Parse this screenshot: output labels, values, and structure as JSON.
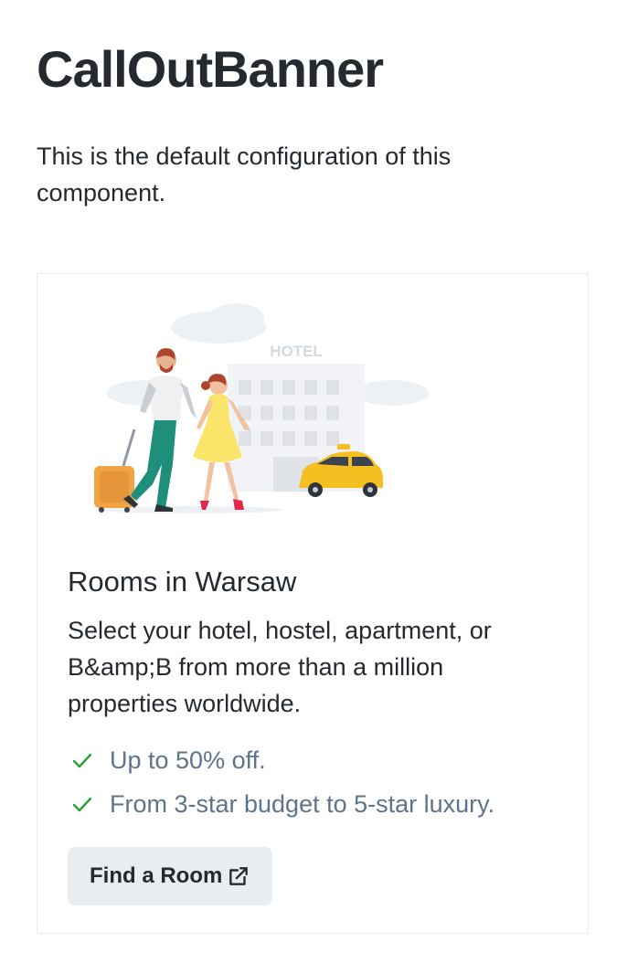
{
  "page": {
    "title": "CallOutBanner",
    "description": "This is the default configuration of this component."
  },
  "banner": {
    "illustration_sign": "HOTEL",
    "title": "Rooms in Warsaw",
    "text": "Select your hotel, hostel, apartment, or B&amp;B from more than a million properties worldwide.",
    "features": [
      {
        "icon": "check-icon",
        "label": "Up to 50% off."
      },
      {
        "icon": "check-icon",
        "label": "From 3-star budget to 5-star luxury."
      }
    ],
    "button": {
      "label": "Find a Room",
      "icon": "external-link-icon"
    }
  },
  "colors": {
    "ink": "#252a31",
    "secondary": "#5f738c",
    "check": "#28a138",
    "button_bg": "#e8edf1",
    "border": "#e8edf1"
  }
}
